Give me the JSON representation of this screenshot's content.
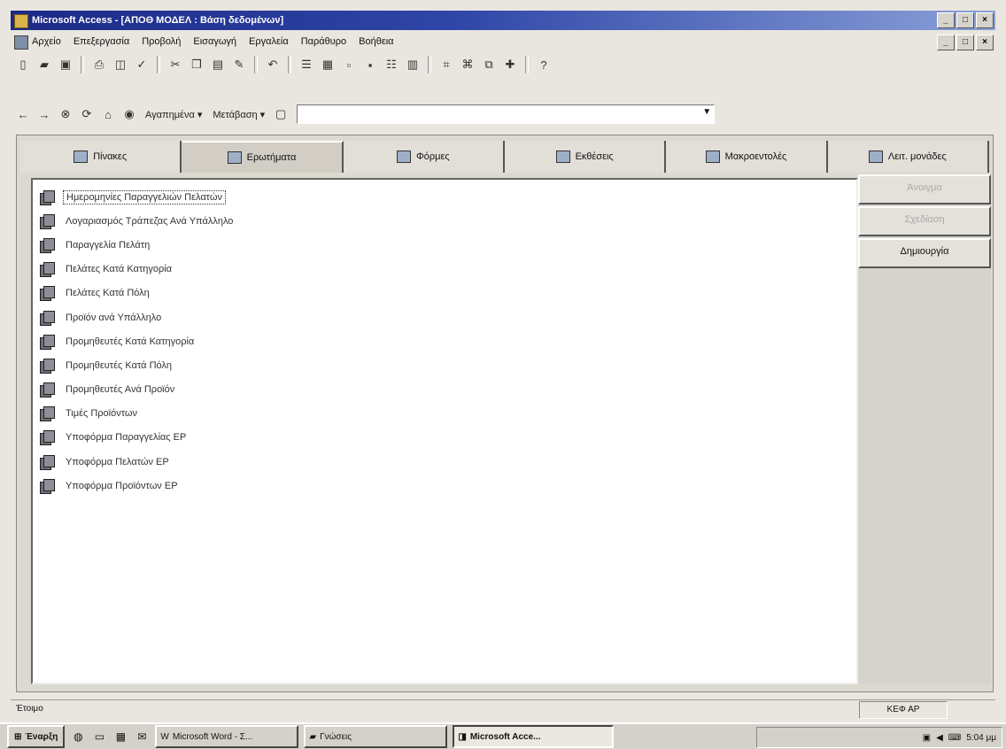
{
  "window": {
    "title": "Microsoft Access - [ΑΠΟΘ ΜΟΔΕΛ : Βάση δεδομένων]",
    "min_label": "_",
    "max_label": "□",
    "close_label": "×"
  },
  "menu": [
    "Αρχείο",
    "Επεξεργασία",
    "Προβολή",
    "Εισαγωγή",
    "Εργαλεία",
    "Παράθυρο",
    "Βοήθεια"
  ],
  "toolbar2": {
    "back_icon": "←",
    "forward_icon": "→",
    "favorites_label": "Αγαπημένα ▾",
    "goto_label": "Μετάβαση ▾",
    "address_value": ""
  },
  "tabs": [
    {
      "label": "Πίνακες",
      "icon": "table-icon"
    },
    {
      "label": "Ερωτήματα",
      "icon": "query-icon",
      "active": true
    },
    {
      "label": "Φόρμες",
      "icon": "form-icon"
    },
    {
      "label": "Εκθέσεις",
      "icon": "report-icon"
    },
    {
      "label": "Μακροεντολές",
      "icon": "macro-icon"
    },
    {
      "label": "Λειτ. μονάδες",
      "icon": "module-icon"
    }
  ],
  "queries": [
    "Ημερομηνίες Παραγγελιών Πελατών",
    "Λογαριασμός Τράπεζας Ανά Υπάλληλο",
    "Παραγγελία Πελάτη",
    "Πελάτες Κατά Κατηγορία",
    "Πελάτες Κατά Πόλη",
    "Προϊόν ανά Υπάλληλο",
    "Προμηθευτές Κατά Κατηγορία",
    "Προμηθευτές Κατά Πόλη",
    "Προμηθευτές Ανά Προϊόν",
    "Τιμές Προϊόντων",
    "Υποφόρμα Παραγγελίας ΕΡ",
    "Υποφόρμα Πελατών ΕΡ",
    "Υποφόρμα Προϊόντων ΕΡ"
  ],
  "side_buttons": {
    "open": "Άνοιγμα",
    "design": "Σχεδίαση",
    "new": "Δημιουργία"
  },
  "status": {
    "text": "Έτοιμο",
    "indicator": "ΚΕΦ ΑΡ"
  },
  "taskbar": {
    "start": "Έναρξη",
    "tasks": [
      {
        "label": "Microsoft Word - Σ..."
      },
      {
        "label": "Γνώσεις"
      },
      {
        "label": "Microsoft Acce...",
        "active": true
      }
    ],
    "clock": "5:04 μμ"
  }
}
